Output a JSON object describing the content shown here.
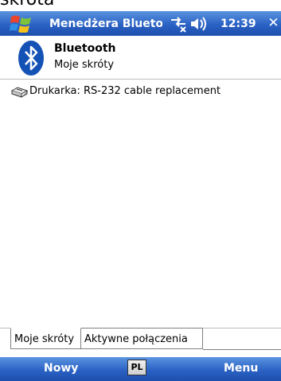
{
  "clipped_top": {
    "text": "skrota"
  },
  "titlebar": {
    "start_icon": "windows-flag-icon",
    "title": "Menedżera Bluetool",
    "status_icons": [
      "connectivity-icon",
      "speaker-icon"
    ],
    "clock": "12:39",
    "close_label": "✕"
  },
  "header": {
    "icon": "bluetooth-icon",
    "title": "Bluetooth",
    "subtitle": "Moje skróty"
  },
  "list": {
    "items": [
      {
        "icon": "printer-shortcut-icon",
        "label": "Drukarka: RS-232 cable replacement"
      }
    ]
  },
  "tabs": [
    {
      "label": "Moje skróty",
      "selected": true
    },
    {
      "label": "Aktywne połączenia",
      "selected": false
    }
  ],
  "softkeys": {
    "left": "Nowy",
    "input_panel": "PL",
    "right": "Menu"
  },
  "colors": {
    "titlebar": "#2a62c4",
    "bluetooth": "#1552b5"
  }
}
